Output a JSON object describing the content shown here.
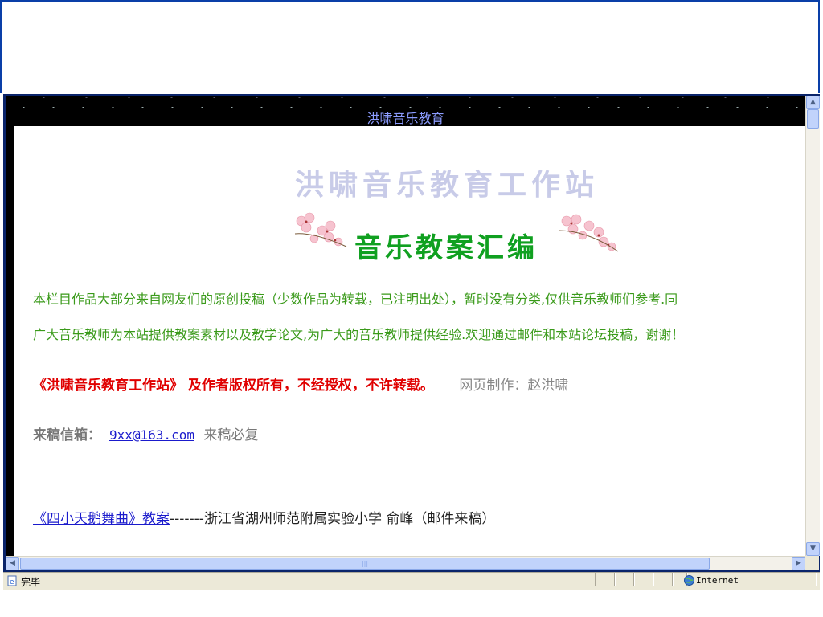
{
  "header": {
    "title": "洪啸音乐教育"
  },
  "site": {
    "title": "洪啸音乐教育工作站"
  },
  "section": {
    "title": "音乐教案汇编"
  },
  "intro": {
    "line1": "本栏目作品大部分来自网友们的原创投稿（少数作品为转载，已注明出处），暂时没有分类,仅供音乐教师们参考.同",
    "line2": "广大音乐教师为本站提供教案素材以及教学论文,为广大的音乐教师提供经验.欢迎通过邮件和本站论坛投稿，谢谢！"
  },
  "copyright": {
    "notice": "《洪啸音乐教育工作站》 及作者版权所有，不经授权，不许转载。",
    "maker": "网页制作：赵洪啸"
  },
  "contact": {
    "label": "来稿信箱：",
    "email": "9xx@163.com",
    "note": "来稿必复"
  },
  "articles": [
    {
      "title": "《四小天鹅舞曲》教案",
      "rest": "-------浙江省湖州师范附属实验小学    俞峰（邮件来稿）"
    }
  ],
  "statusbar": {
    "text": "完毕",
    "zone": "Internet"
  },
  "icons": {
    "status": "ie-page-icon",
    "zone": "globe-icon"
  },
  "colors": {
    "accent_green": "#3a9a1a",
    "copyright_red": "#e00000",
    "link_blue": "#1a1acc",
    "header_text": "#8c9cff"
  }
}
